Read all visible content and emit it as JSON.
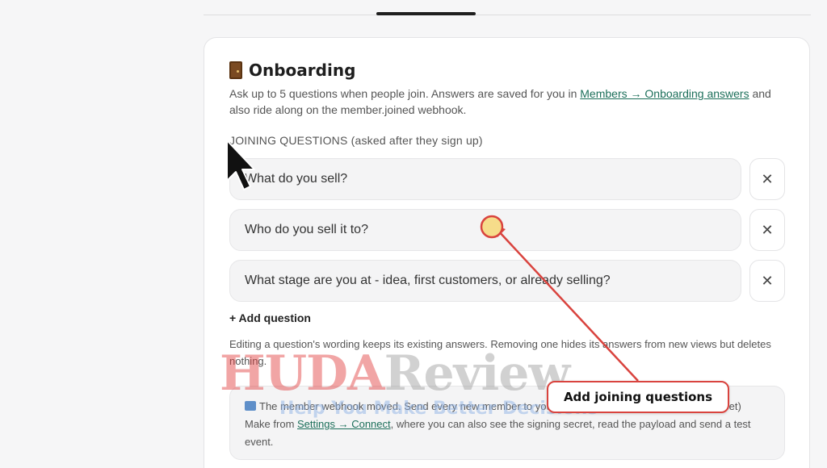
{
  "section": {
    "title": "Onboarding",
    "title_icon": "door-icon",
    "desc_prefix": "Ask up to 5 questions when people join. Answers are saved for you in ",
    "desc_link": "Members → Onboarding answers",
    "desc_suffix": " and also ride along on the member.joined webhook."
  },
  "questions": {
    "label": "JOINING QUESTIONS (asked after they sign up)",
    "items": [
      {
        "text": "What do you sell?"
      },
      {
        "text": "Who do you sell it to?"
      },
      {
        "text": "What stage are you at - idea, first customers, or already selling?"
      }
    ],
    "remove_glyph": "✕",
    "add_label": "+ Add question"
  },
  "note": "Editing a question's wording keeps its existing answers. Removing one hides its answers from new views but deletes nothing.",
  "info": {
    "icon": "inbox-icon",
    "text_part1": "The member webhook moved. Send every new member to your own tools (a Zap, Make, Google Sheet) Make from ",
    "link": "Settings → Connect",
    "text_part2": ", where you can also see the signing secret, read the payload and send a test event."
  },
  "watermark": {
    "main_red": "HUDA",
    "main_grey": "Review",
    "sub": "Help You Make Better Decisions"
  },
  "annotation": {
    "callout": "Add joining questions",
    "colors": {
      "arrow": "#d9433e",
      "marker": "#f6dc8a"
    }
  },
  "colors": {
    "link": "#1c6f5a",
    "card": "#ffffff",
    "field": "#f4f4f5"
  }
}
